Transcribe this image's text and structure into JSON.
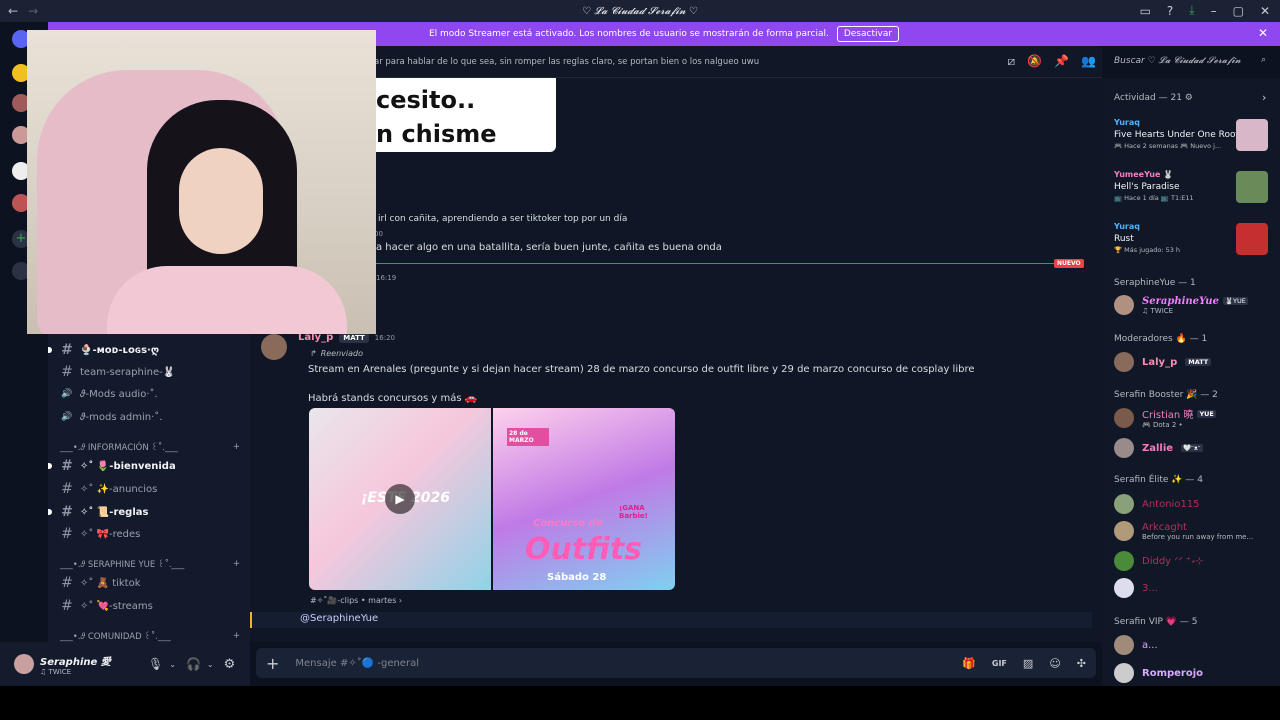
{
  "window": {
    "title": "♡ 𝓛𝓪 𝓒𝓲𝓾𝓭𝓪𝓭 𝓢𝓮𝓻𝓪𝓯𝓲𝓷 ♡"
  },
  "banner": {
    "text": "El modo Streamer está activado. Los nombres de usuario se mostrarán de forma parcial.",
    "button": "Desactivar"
  },
  "header": {
    "topic": "ar para hablar de lo que sea, sin romper las reglas claro, se portan bien o los nalgueo uwu",
    "search_placeholder": "Buscar ♡ 𝓛𝓪 𝓒𝓲𝓾𝓭𝓪𝓭 𝓢𝓮𝓻𝓪𝓯𝓲𝓷"
  },
  "channels": {
    "items": [
      {
        "icon": "#",
        "label": "🍨-ᴍᴏᴅ-ʟᴏɢꜱ·ღ",
        "unread": true
      },
      {
        "icon": "#",
        "label": "team-seraphine-🐰",
        "unread": false
      },
      {
        "icon": "🔊",
        "label": "𝜗-Mods audio·˚.",
        "unread": false
      },
      {
        "icon": "🔊",
        "label": "𝜗-mods admin·˚.",
        "unread": false
      }
    ],
    "cat_info": "___•.𝜗 INFORMACIÓN ꒰˚.___",
    "info_items": [
      {
        "icon": "#",
        "label": "✧˚ 🌷-bienvenida",
        "unread": true
      },
      {
        "icon": "#",
        "label": "✧˚ ✨-anuncios",
        "unread": false
      },
      {
        "icon": "#",
        "label": "✧˚ 📜-reglas",
        "unread": true
      },
      {
        "icon": "#",
        "label": "✧˚ 🎀-redes",
        "unread": false
      }
    ],
    "cat_seraphine": "___•.𝜗 SERAPHINE YUE ꒰˚.___",
    "ser_items": [
      {
        "icon": "#",
        "label": "✧˚ 🧸 tiktok",
        "unread": false
      },
      {
        "icon": "#",
        "label": "✧˚ 💘-streams",
        "unread": false
      }
    ],
    "cat_comunidad": "___•.𝜗 COMUNIDAD ꒰˚.___"
  },
  "user": {
    "name": "Seraphine 愛",
    "status": "♫ TWICE"
  },
  "chat": {
    "meme_text_1": "cesito..",
    "meme_text_2": "n chisme",
    "line1": "irl con cañita, aprendiendo a ser tiktoker top por un día",
    "line1_time": "00",
    "line2": "a hacer algo en una batallita, sería buen junte, cañita es buena onda",
    "new_label": "NUEVO",
    "time3": "16:19",
    "author": "Laly_p",
    "author_tag": "MATT",
    "author_time": "16:20",
    "forwarded": "Reenviado",
    "body1": "Stream en Arenales (pregunte y si dejan hacer stream) 28 de marzo concurso de outfit libre y 29 de marzo concurso de cosplay libre",
    "body2": "Habrá stands concursos y más 🚗",
    "img1_text": "¡ESTE 2026",
    "img2_top": "28 de MARZO",
    "img2_title": "Outfits",
    "img2_sub": "Concurso de",
    "img2_sat": "Sábado 28",
    "img2_win": "¡GANA Barbie!",
    "forward_src": "#✧˚🎥-clips • martes ›",
    "mention": "@SeraphineYue"
  },
  "composer": {
    "placeholder": "Mensaje #✧˚🔵 -general"
  },
  "members": {
    "activity_head": "Actividad — 21 ⚙",
    "activities": [
      {
        "user": "Yuraq",
        "title": "Five Hearts Under One Roof",
        "sub": "🎮 Hace 2 semanas  🎮 Nuevo j..."
      },
      {
        "user": "YumeeYue 🐰",
        "title": "Hell's Paradise",
        "sub": "📺 Hace 1 día  📺 T1:E11"
      },
      {
        "user": "Yuraq",
        "title": "Rust",
        "sub": "🏆 Más jugado: 53 h"
      }
    ],
    "g1_head": "SeraphineYue — 1",
    "g1": [
      {
        "name": "SeraphineYue",
        "tag": "🐰YUE",
        "sub": "♫ TWICE",
        "color": "#f47fff"
      }
    ],
    "g2_head": "Moderadores 🔥 — 1",
    "g2": [
      {
        "name": "Laly_p",
        "tag": "MATT",
        "sub": "",
        "color": "#f78fb3"
      }
    ],
    "g3_head": "Serafin Booster 🎉 — 2",
    "g3": [
      {
        "name": "Cristian 曉",
        "tag": "YUE",
        "sub": "🎮 Dota 2 •",
        "color": "#f47fbf"
      },
      {
        "name": "Zallie",
        "tag": "🤍ᵔᴥᵔ",
        "sub": "",
        "color": "#f47fbf"
      }
    ],
    "g4_head": "Serafin Élite ✨ — 4",
    "g4": [
      {
        "name": "Antonio115",
        "sub": "",
        "color": "#b0305a"
      },
      {
        "name": "Arkcaght",
        "sub": "Before you run away from me...",
        "color": "#b0305a"
      },
      {
        "name": "Diddy ᐟᐟ ⁺˖⊹",
        "sub": "",
        "color": "#b0305a"
      },
      {
        "name": "3...",
        "sub": "",
        "color": "#b0305a"
      }
    ],
    "g5_head": "Serafin VIP 💗 — 5",
    "g5": [
      {
        "name": "a...",
        "sub": "",
        "color": "#d9a8ff"
      },
      {
        "name": "Romperojo",
        "sub": "",
        "color": "#d9a8ff"
      }
    ]
  }
}
